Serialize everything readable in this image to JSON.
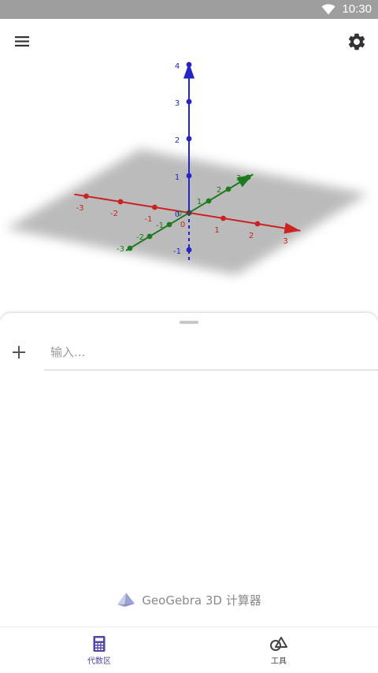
{
  "status_bar": {
    "time": "10:30",
    "wifi_icon": "wifi-icon"
  },
  "toolbar": {
    "menu_icon": "menu-icon",
    "settings_icon": "gear-icon"
  },
  "graphics": {
    "axes": {
      "x": {
        "color": "#cc2222",
        "ticks": [
          "-3",
          "-2",
          "-1",
          "0",
          "1",
          "2",
          "3"
        ]
      },
      "y": {
        "color": "#1e7a1e",
        "ticks": [
          "-3",
          "-2",
          "-1",
          "0",
          "1",
          "2",
          "3"
        ]
      },
      "z": {
        "color": "#2424c8",
        "ticks": [
          "-1",
          "0",
          "1",
          "2",
          "3",
          "4"
        ]
      }
    },
    "plane_color": "#b4b4b4"
  },
  "algebra": {
    "add_icon": "plus-icon",
    "input_placeholder": "输入..."
  },
  "brand": {
    "name": "GeoGebra 3D 计算器",
    "logo_icon": "pyramid-logo-icon"
  },
  "bottom_nav": {
    "items": [
      {
        "label": "代数区",
        "icon": "calculator-icon",
        "active": true
      },
      {
        "label": "工具",
        "icon": "tools-icon",
        "active": false
      }
    ],
    "active_color": "#5145a8"
  }
}
